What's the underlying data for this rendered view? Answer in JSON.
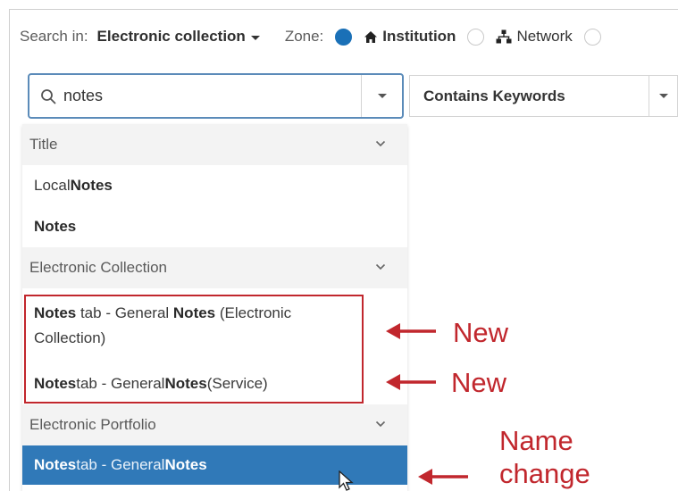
{
  "search_bar": {
    "search_in_label": "Search in:",
    "scope_value": "Electronic collection",
    "zone_label": "Zone:",
    "zones": [
      {
        "label": "Institution",
        "icon": "home-icon",
        "selected": true
      },
      {
        "label": "Network",
        "icon": "network-icon",
        "selected": false
      }
    ]
  },
  "search": {
    "value": "notes",
    "placeholder": ""
  },
  "operator": {
    "value": "Contains Keywords"
  },
  "dropdown": {
    "groups": [
      {
        "header": "Title",
        "items": [
          {
            "parts": [
              {
                "text": "Local ",
                "bold": false
              },
              {
                "text": "Notes",
                "bold": true
              }
            ]
          },
          {
            "parts": [
              {
                "text": "Notes",
                "bold": true
              }
            ]
          }
        ]
      },
      {
        "header": "Electronic Collection",
        "items": [
          {
            "parts": [
              {
                "text": "Notes",
                "bold": true
              },
              {
                "text": " tab - General ",
                "bold": false
              },
              {
                "text": "Notes",
                "bold": true
              },
              {
                "text": " (Electronic Collection)",
                "bold": false
              }
            ],
            "multiline": true
          },
          {
            "parts": [
              {
                "text": "Notes",
                "bold": true
              },
              {
                "text": " tab - General ",
                "bold": false
              },
              {
                "text": "Notes",
                "bold": true
              },
              {
                "text": " (Service)",
                "bold": false
              }
            ]
          }
        ]
      },
      {
        "header": "Electronic Portfolio",
        "items": [
          {
            "parts": [
              {
                "text": "Notes",
                "bold": true
              },
              {
                "text": " tab - General ",
                "bold": false
              },
              {
                "text": "Notes",
                "bold": true
              }
            ],
            "selected": true
          }
        ]
      }
    ]
  },
  "annotations": {
    "new_1": "New",
    "new_2": "New",
    "name_change_line1": "Name",
    "name_change_line2": "change",
    "color": "#c1272d"
  },
  "colors": {
    "accent": "#1a70b7",
    "selected_row": "#3079b8",
    "search_border": "#5b8bb9"
  }
}
